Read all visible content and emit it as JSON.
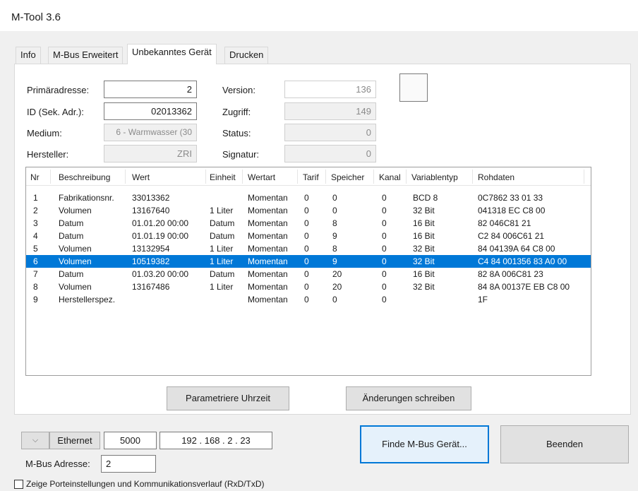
{
  "window": {
    "title": "M-Tool 3.6"
  },
  "tabs": [
    "Info",
    "M-Bus Erweitert",
    "Unbekanntes Gerät",
    "Drucken"
  ],
  "device": {
    "primaeradresse_label": "Primäradresse:",
    "primaeradresse_value": "2",
    "id_label": "ID (Sek. Adr.):",
    "id_value": "02013362",
    "medium_label": "Medium:",
    "medium_value": "6 - Warmwasser (30",
    "hersteller_label": "Hersteller:",
    "hersteller_value": "ZRI",
    "version_label": "Version:",
    "version_value": "136",
    "zugriff_label": "Zugriff:",
    "zugriff_value": "149",
    "status_label": "Status:",
    "status_value": "0",
    "signatur_label": "Signatur:",
    "signatur_value": "0"
  },
  "table": {
    "columns": [
      "Nr",
      "Beschreibung",
      "Wert",
      "Einheit",
      "Wertart",
      "Tarif",
      "Speicher",
      "Kanal",
      "Variablentyp",
      "Rohdaten"
    ],
    "rows": [
      [
        "1",
        "Fabrikationsnr.",
        "33013362",
        "",
        "Momentan",
        "0",
        "0",
        "0",
        "BCD 8",
        "0C7862 33 01 33"
      ],
      [
        "2",
        "Volumen",
        "13167640",
        "1 Liter",
        "Momentan",
        "0",
        "0",
        "0",
        "32 Bit",
        "041318 EC C8 00"
      ],
      [
        "3",
        "Datum",
        "01.01.20 00:00",
        "Datum",
        "Momentan",
        "0",
        "8",
        "0",
        "16 Bit",
        "82 046C81 21"
      ],
      [
        "4",
        "Datum",
        "01.01.19 00:00",
        "Datum",
        "Momentan",
        "0",
        "9",
        "0",
        "16 Bit",
        "C2 84 006C61 21"
      ],
      [
        "5",
        "Volumen",
        "13132954",
        "1 Liter",
        "Momentan",
        "0",
        "8",
        "0",
        "32 Bit",
        "84 04139A 64 C8 00"
      ],
      [
        "6",
        "Volumen",
        "10519382",
        "1 Liter",
        "Momentan",
        "0",
        "9",
        "0",
        "32 Bit",
        "C4 84 001356 83 A0 00"
      ],
      [
        "7",
        "Datum",
        "01.03.20 00:00",
        "Datum",
        "Momentan",
        "0",
        "20",
        "0",
        "16 Bit",
        "82 8A 006C81 23"
      ],
      [
        "8",
        "Volumen",
        "13167486",
        "1 Liter",
        "Momentan",
        "0",
        "20",
        "0",
        "32 Bit",
        "84 8A 00137E EB C8 00"
      ],
      [
        "9",
        "Herstellerspez.",
        "",
        "",
        "Momentan",
        "0",
        "0",
        "0",
        "",
        "1F"
      ]
    ],
    "selected_row": "6"
  },
  "buttons": {
    "parametriere": "Parametriere Uhrzeit",
    "aenderungen": "Änderungen schreiben",
    "finde": "Finde M-Bus Gerät...",
    "beenden": "Beenden"
  },
  "connection": {
    "dropdown_icon": "chevron-down-icon",
    "type": "Ethernet",
    "port": "5000",
    "ip": "192 . 168 . 2 . 23",
    "mbus_label": "M-Bus Adresse:",
    "mbus_value": "2"
  },
  "options": {
    "show_ports_label": "Zeige Porteinstellungen und Kommunikationsverlauf (RxD/TxD)"
  },
  "colors": {
    "selection": "#0078d7",
    "window_bg": "#f0f0f0"
  }
}
